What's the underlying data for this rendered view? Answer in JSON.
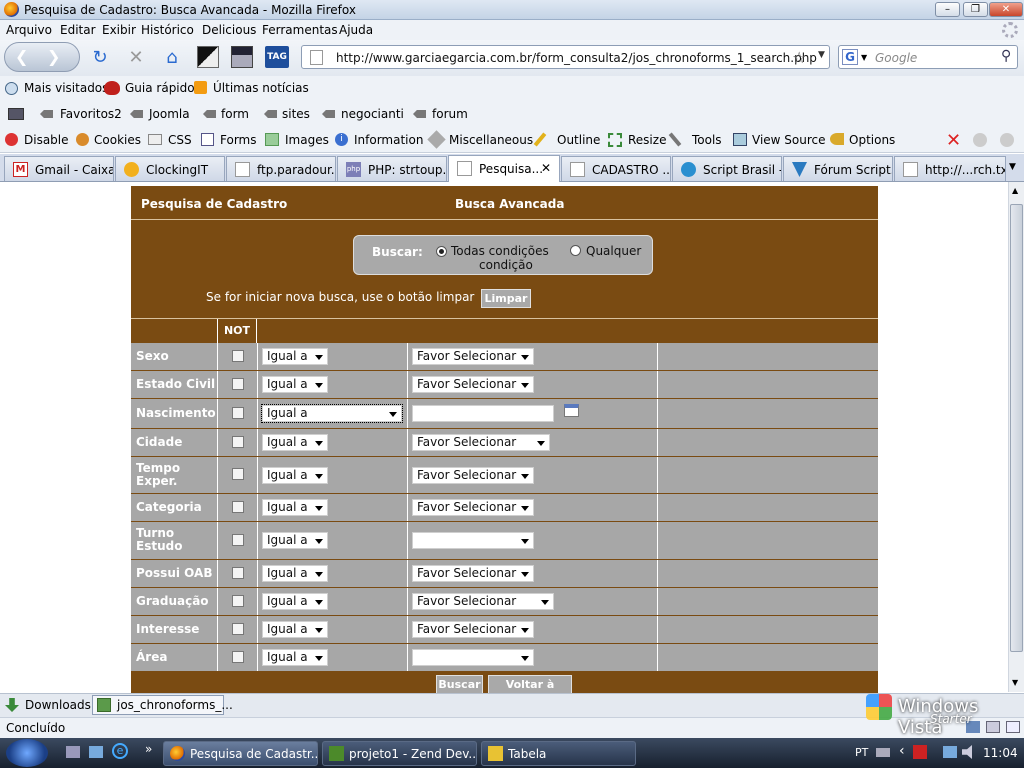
{
  "window": {
    "title": "Pesquisa de Cadastro: Busca Avancada - Mozilla Firefox"
  },
  "menu": [
    "Arquivo",
    "Editar",
    "Exibir",
    "Histórico",
    "Delicious",
    "Ferramentas",
    "Ajuda"
  ],
  "navigation": {
    "url": "http://www.garciaegarcia.com.br/form_consulta2/jos_chronoforms_1_search.php",
    "search_placeholder": "Google",
    "tag_label": "TAG"
  },
  "bookmarks": {
    "row1": [
      "Mais visitados",
      "Guia rápido",
      "Últimas notícias"
    ],
    "row2": [
      "Favoritos2",
      "Joomla",
      "form",
      "sites",
      "negocianti",
      "forum"
    ]
  },
  "devbar": [
    "Disable",
    "Cookies",
    "CSS",
    "Forms",
    "Images",
    "Information",
    "Miscellaneous",
    "Outline",
    "Resize",
    "Tools",
    "View Source",
    "Options"
  ],
  "tabs": [
    "Gmail - Caixa...",
    "ClockingIT",
    "ftp.paradour...",
    "PHP: strtoup...",
    "Pesquisa...",
    "CADASTRO ...",
    "Script Brasil -...",
    "Fórum Script...",
    "http://...rch.txt"
  ],
  "form": {
    "header_left": "Pesquisa de Cadastro",
    "header_center": "Busca Avancada",
    "buscar_label": "Buscar:",
    "option_all": "Todas condições",
    "option_all_2": "condição",
    "option_any": "Qualquer",
    "hint": "Se for iniciar nova busca, use o botão limpar",
    "limpar": "Limpar",
    "not_header": "NOT",
    "buscar_btn": "Buscar",
    "voltar_btn": "Voltar à Lista",
    "rows": [
      {
        "label": "Sexo",
        "op": "Igual a",
        "value": "Favor Selecionar"
      },
      {
        "label": "Estado Civil",
        "op": "Igual a",
        "value": "Favor Selecionar"
      },
      {
        "label": "Nascimento",
        "op": "Igual a",
        "value": ""
      },
      {
        "label": "Cidade",
        "op": "Igual a",
        "value": "Favor Selecionar"
      },
      {
        "label": "Tempo Exper.",
        "op": "Igual a",
        "value": "Favor Selecionar"
      },
      {
        "label": "Categoria",
        "op": "Igual a",
        "value": "Favor Selecionar"
      },
      {
        "label": "Turno Estudo",
        "op": "Igual a",
        "value": ""
      },
      {
        "label": "Possui OAB",
        "op": "Igual a",
        "value": "Favor Selecionar"
      },
      {
        "label": "Graduação",
        "op": "Igual a",
        "value": "Favor Selecionar"
      },
      {
        "label": "Interesse",
        "op": "Igual a",
        "value": "Favor Selecionar"
      },
      {
        "label": "Área",
        "op": "Igual a",
        "value": ""
      }
    ]
  },
  "downloads": {
    "label": "Downloads",
    "file": "jos_chronoforms_..."
  },
  "status": {
    "text": "Concluído",
    "watermark": "Windows Vista",
    "watermark_2": "Starter"
  },
  "taskbar": {
    "items": [
      "Pesquisa de Cadastr...",
      "projeto1 - Zend Dev...",
      "Tabela"
    ],
    "lang": "PT",
    "time": "11:04"
  }
}
